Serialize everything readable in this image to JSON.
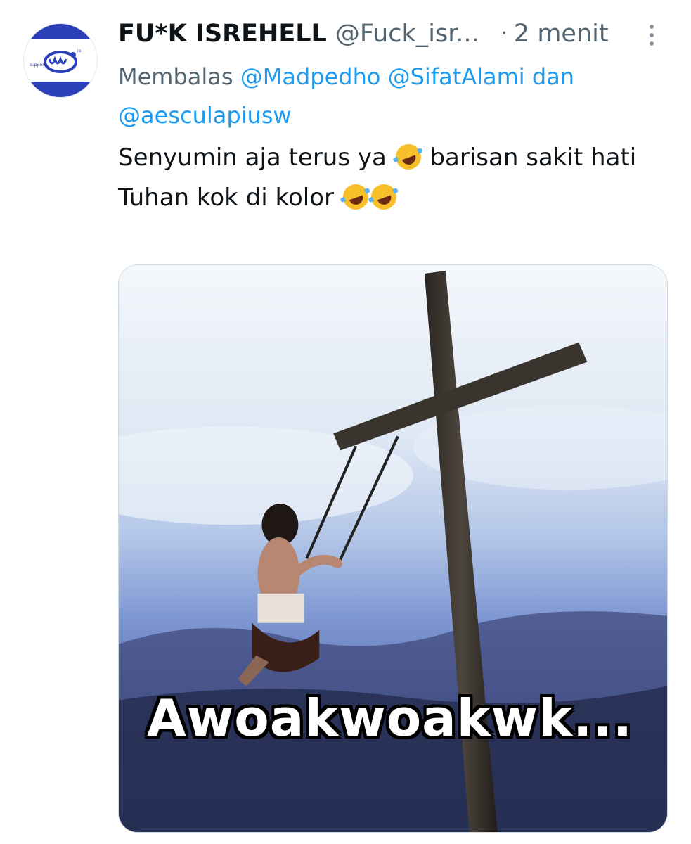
{
  "tweet": {
    "display_name": "FU*K ISREHELL",
    "handle": "@Fuck_isr...",
    "separator": "·",
    "time": "2 menit",
    "more_icon": "more-vertical-icon",
    "reply": {
      "prefix": "Membalas",
      "mentions": [
        "@Madpedho",
        "@SifatAlami"
      ],
      "conjunction": "dan",
      "last_mention": "@aesculapiusw"
    },
    "body": {
      "line1_a": "Senyumin aja terus ya",
      "line1_b": "barisan sakit hati",
      "line2": "Tuhan kok di kolor"
    },
    "emoji_name": "rolling-on-the-floor-laughing",
    "media": {
      "caption": "Awoakwoakwk..."
    }
  },
  "colors": {
    "text": "#0f1419",
    "secondary": "#536471",
    "link": "#1d9bf0",
    "avatar_stripe": "#2a3fb8"
  }
}
